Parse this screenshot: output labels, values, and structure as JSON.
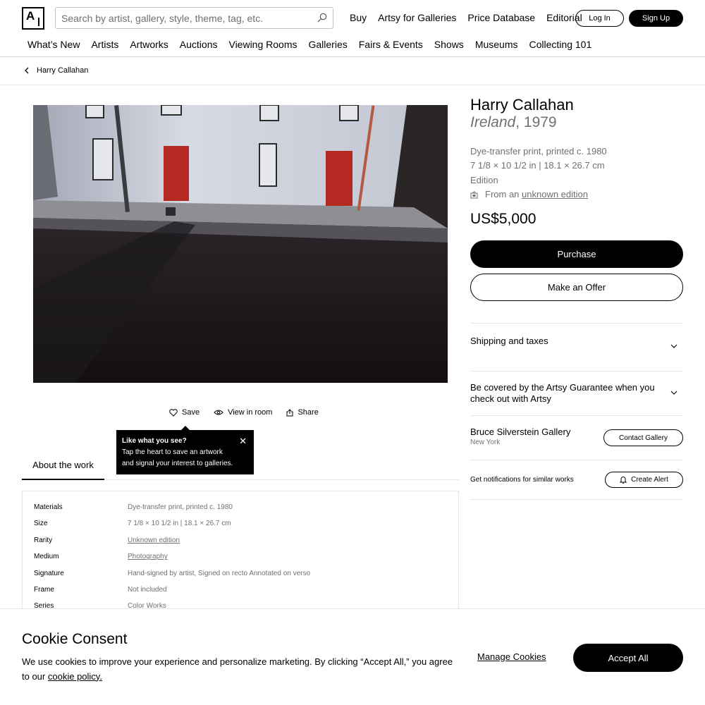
{
  "header": {
    "search_placeholder": "Search by artist, gallery, style, theme, tag, etc.",
    "top_links": [
      "Buy",
      "Artsy for Galleries",
      "Price Database",
      "Editorial"
    ],
    "login": "Log In",
    "signup": "Sign Up"
  },
  "nav": [
    "What’s New",
    "Artists",
    "Artworks",
    "Auctions",
    "Viewing Rooms",
    "Galleries",
    "Fairs & Events",
    "Shows",
    "Museums",
    "Collecting 101"
  ],
  "breadcrumb": "Harry Callahan",
  "actions": {
    "save": "Save",
    "view_in_room": "View in room",
    "share": "Share"
  },
  "tooltip": {
    "title": "Like what you see?",
    "line1": "Tap the heart to save an artwork",
    "line2": "and signal your interest to galleries."
  },
  "tabs": {
    "about": "About the work"
  },
  "details": [
    {
      "label": "Materials",
      "value": "Dye-transfer print, printed c. 1980",
      "link": false
    },
    {
      "label": "Size",
      "value": "7 1/8 × 10 1/2 in | 18.1 × 26.7 cm",
      "link": false
    },
    {
      "label": "Rarity",
      "value": "Unknown edition",
      "link": true
    },
    {
      "label": "Medium",
      "value": "Photography",
      "link": true
    },
    {
      "label": "Signature",
      "value": "Hand-signed by artist, Signed on recto Annotated on verso",
      "link": false
    },
    {
      "label": "Frame",
      "value": "Not included",
      "link": false
    },
    {
      "label": "Series",
      "value": "Color Works",
      "link": false
    }
  ],
  "artwork": {
    "artist": "Harry Callahan",
    "title": "Ireland",
    "year": ", 1979",
    "materials": "Dye-transfer print, printed c. 1980",
    "size": "7 1/8 × 10 1/2 in | 18.1 × 26.7 cm",
    "edition": "Edition",
    "edition_prefix": "From an",
    "edition_link": "unknown edition",
    "price": "US$5,000",
    "purchase": "Purchase",
    "offer": "Make an Offer"
  },
  "accordion": {
    "shipping": "Shipping and taxes",
    "guarantee": "Be covered by the Artsy Guarantee when you check out with Artsy"
  },
  "gallery": {
    "name": "Bruce Silverstein Gallery",
    "location": "New York",
    "contact": "Contact Gallery"
  },
  "alerts": {
    "text": "Get notifications for similar works",
    "button": "Create Alert"
  },
  "cookie": {
    "title": "Cookie Consent",
    "text": "We use cookies to improve your experience and personalize marketing. By clicking “Accept All,” you agree to our",
    "link": "cookie policy.",
    "manage": "Manage Cookies",
    "accept": "Accept All"
  }
}
